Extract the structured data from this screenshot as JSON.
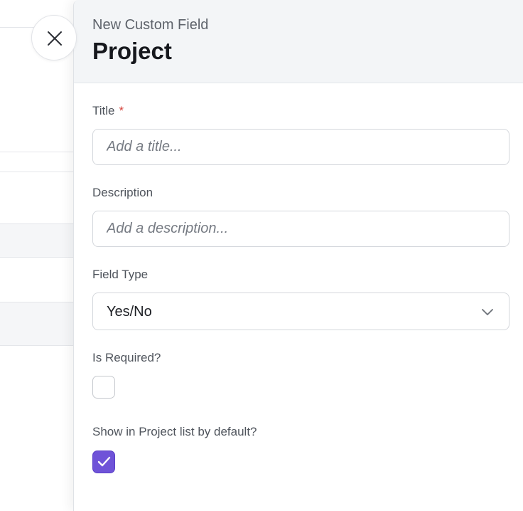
{
  "panel": {
    "subtitle": "New Custom Field",
    "title": "Project"
  },
  "form": {
    "title_label": "Title",
    "title_required_marker": "*",
    "title_placeholder": "Add a title...",
    "description_label": "Description",
    "description_placeholder": "Add a description...",
    "field_type_label": "Field Type",
    "field_type_value": "Yes/No",
    "is_required_label": "Is Required?",
    "is_required_checked": false,
    "show_in_list_label": "Show in Project list by default?",
    "show_in_list_checked": true
  },
  "icons": {
    "close": "close-icon",
    "chevron": "chevron-down-icon",
    "check": "checkmark-icon"
  },
  "colors": {
    "accent": "#6f53d8",
    "required": "#d6433b",
    "header_bg": "#f3f5f7"
  }
}
